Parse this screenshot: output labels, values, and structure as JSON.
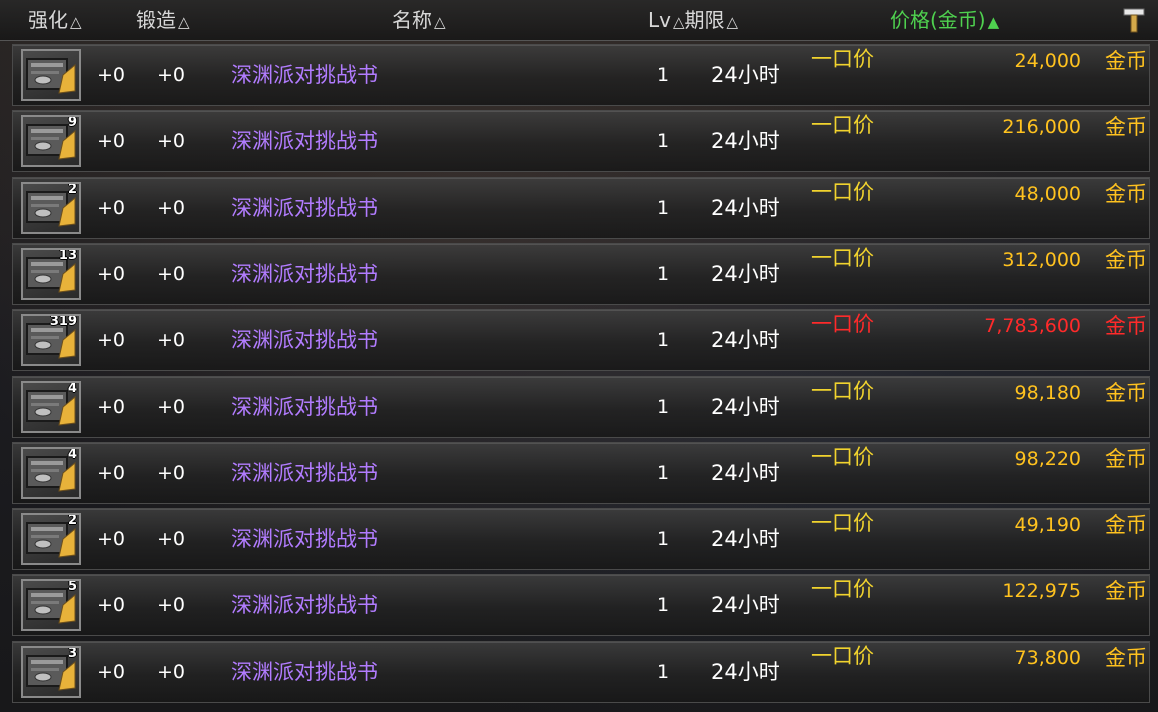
{
  "header": {
    "qianghua": "强化",
    "duanzao": "锻造",
    "mingcheng": "名称",
    "lv": "Lv",
    "qixian": "期限",
    "price": "价格(金币)",
    "sort_asc_icon": "triangle-outline",
    "sort_active_icon": "triangle-filled",
    "hammer_icon": "hammer-icon"
  },
  "colors": {
    "name": "#b27cff",
    "price": "#ffc21f",
    "highlight": "#ff2a2a",
    "active_sort": "#4fd14f"
  },
  "rows": [
    {
      "qty": "",
      "qianghua": "+0",
      "duanzao": "+0",
      "name": "深渊派对挑战书",
      "lv": "1",
      "expire": "24小时",
      "type": "一口价",
      "price": "24,000",
      "currency": "金币",
      "highlight": false
    },
    {
      "qty": "9",
      "qianghua": "+0",
      "duanzao": "+0",
      "name": "深渊派对挑战书",
      "lv": "1",
      "expire": "24小时",
      "type": "一口价",
      "price": "216,000",
      "currency": "金币",
      "highlight": false
    },
    {
      "qty": "2",
      "qianghua": "+0",
      "duanzao": "+0",
      "name": "深渊派对挑战书",
      "lv": "1",
      "expire": "24小时",
      "type": "一口价",
      "price": "48,000",
      "currency": "金币",
      "highlight": false
    },
    {
      "qty": "13",
      "qianghua": "+0",
      "duanzao": "+0",
      "name": "深渊派对挑战书",
      "lv": "1",
      "expire": "24小时",
      "type": "一口价",
      "price": "312,000",
      "currency": "金币",
      "highlight": false
    },
    {
      "qty": "319",
      "qianghua": "+0",
      "duanzao": "+0",
      "name": "深渊派对挑战书",
      "lv": "1",
      "expire": "24小时",
      "type": "一口价",
      "price": "7,783,600",
      "currency": "金币",
      "highlight": true
    },
    {
      "qty": "4",
      "qianghua": "+0",
      "duanzao": "+0",
      "name": "深渊派对挑战书",
      "lv": "1",
      "expire": "24小时",
      "type": "一口价",
      "price": "98,180",
      "currency": "金币",
      "highlight": false
    },
    {
      "qty": "4",
      "qianghua": "+0",
      "duanzao": "+0",
      "name": "深渊派对挑战书",
      "lv": "1",
      "expire": "24小时",
      "type": "一口价",
      "price": "98,220",
      "currency": "金币",
      "highlight": false
    },
    {
      "qty": "2",
      "qianghua": "+0",
      "duanzao": "+0",
      "name": "深渊派对挑战书",
      "lv": "1",
      "expire": "24小时",
      "type": "一口价",
      "price": "49,190",
      "currency": "金币",
      "highlight": false
    },
    {
      "qty": "5",
      "qianghua": "+0",
      "duanzao": "+0",
      "name": "深渊派对挑战书",
      "lv": "1",
      "expire": "24小时",
      "type": "一口价",
      "price": "122,975",
      "currency": "金币",
      "highlight": false
    },
    {
      "qty": "3",
      "qianghua": "+0",
      "duanzao": "+0",
      "name": "深渊派对挑战书",
      "lv": "1",
      "expire": "24小时",
      "type": "一口价",
      "price": "73,800",
      "currency": "金币",
      "highlight": false
    }
  ]
}
